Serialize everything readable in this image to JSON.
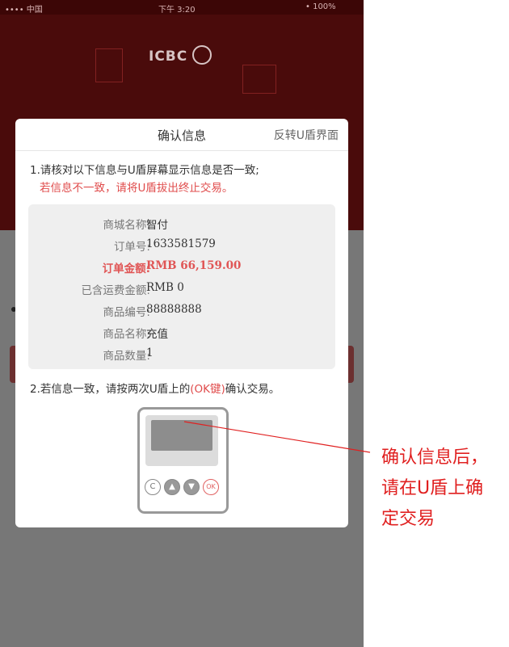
{
  "background": {
    "logo_text": "ICBC",
    "statusbar": {
      "left": "•••• 中国",
      "center": "下午 3:20",
      "right": "• 100%"
    }
  },
  "dialog": {
    "title": "确认信息",
    "flip_link": "反转U盾界面",
    "step1": "1.请核对以下信息与U盾屏幕显示信息是否一致;",
    "warning": "若信息不一致，请将U盾拔出终止交易。",
    "info": [
      {
        "label": "商城名称:",
        "value": "智付",
        "highlight": false
      },
      {
        "label": "订单号:",
        "value": "1633581579",
        "highlight": false
      },
      {
        "label": "订单金额:",
        "value": "RMB 66,159.00",
        "highlight": true
      },
      {
        "label": "已含运费金额:",
        "value": "RMB 0",
        "highlight": false
      },
      {
        "label": "商品编号:",
        "value": "88888888",
        "highlight": false
      },
      {
        "label": "商品名称:",
        "value": "充值",
        "highlight": false
      },
      {
        "label": "商品数量:",
        "value": "1",
        "highlight": false
      }
    ],
    "step2_prefix": "2.若信息一致，请按两次U盾上的",
    "step2_key": "(OK键)",
    "step2_suffix": "确认交易。",
    "device": {
      "buttons": [
        {
          "name": "c-button",
          "glyph": "C"
        },
        {
          "name": "up-button",
          "glyph": "▲"
        },
        {
          "name": "down-button",
          "glyph": "▼"
        },
        {
          "name": "ok-button",
          "glyph": "OK"
        }
      ]
    }
  },
  "annotation": {
    "lines": [
      "确认信息后，",
      "请在U盾上确",
      "定交易"
    ],
    "color": "#e02020"
  },
  "colors": {
    "accent_red": "#e04c4c",
    "header_bg": "#4a0b0b"
  }
}
